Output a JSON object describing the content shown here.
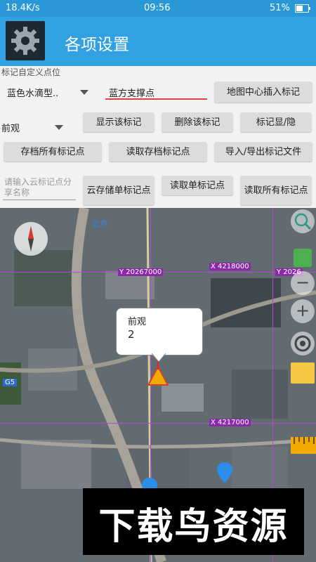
{
  "status_bar": {
    "speed": "18.4K/s",
    "time": "09:56",
    "battery": "51%"
  },
  "app_bar": {
    "title": "各项设置",
    "icon": "gear-icon"
  },
  "panel": {
    "label_custom_point": "标记自定义点位",
    "marker_style_select": "蓝色水滴型..",
    "marker_name_input": "蓝方支撑点",
    "insert_center_button": "地图中心插入标记",
    "marker_select": "前观",
    "show_marker_button": "显示该标记",
    "delete_marker_button": "删除该标记",
    "toggle_marker_button": "标记显/隐",
    "archive_all_button": "存档所有标记点",
    "read_archive_button": "读取存档标记点",
    "import_export_button": "导入/导出标记文件",
    "cloud_share_placeholder": "请输入云标记点分享名称",
    "cloud_save_single_button": "云存储单标记点",
    "read_single_button": "读取单标记点",
    "read_all_button": "读取所有标记点"
  },
  "map": {
    "location_label": "北京",
    "coord_y1": "Y 20267000",
    "coord_x1": "X 4218000",
    "coord_y2": "Y 2026",
    "coord_x2": "X 4217000",
    "road_label": "G5",
    "popup_name": "前观",
    "popup_value": "2",
    "controls": [
      "search-icon",
      "minus-icon",
      "plus-icon",
      "locate-icon",
      "folder-icon",
      "ruler-icon"
    ],
    "colors": {
      "grid": "#b548d8",
      "accent": "#31a1e2",
      "warning": "#f2a900"
    }
  },
  "watermark": {
    "text": "下载鸟资源"
  }
}
